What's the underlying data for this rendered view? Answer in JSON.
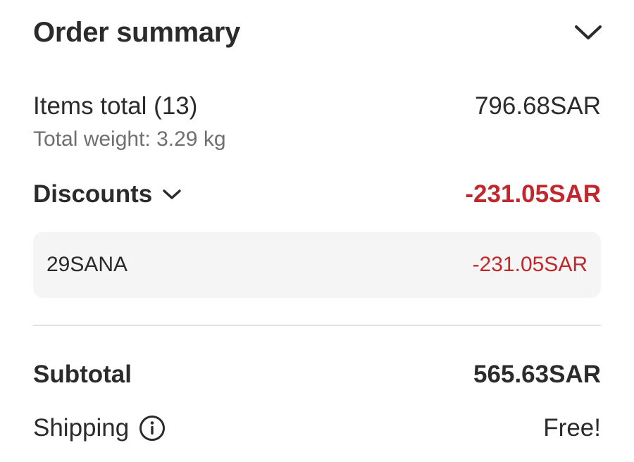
{
  "header": {
    "title": "Order summary",
    "toggle_icon": "chevron-down-icon"
  },
  "items": {
    "label": "Items total (13)",
    "value": "796.68SAR",
    "weight": "Total weight: 3.29 kg"
  },
  "discounts": {
    "label": "Discounts",
    "value": "-231.05SAR",
    "toggle_icon": "chevron-down-icon",
    "coupons": [
      {
        "code": "29SANA",
        "value": "-231.05SAR"
      }
    ]
  },
  "subtotal": {
    "label": "Subtotal",
    "value": "565.63SAR"
  },
  "shipping": {
    "label": "Shipping",
    "value": "Free!",
    "info_icon": "info-icon"
  },
  "colors": {
    "text": "#2b2b2b",
    "muted": "#6f6f6f",
    "discount": "#c0282d",
    "coupon_bg": "#f5f5f5",
    "divider": "#e2e2e2"
  }
}
